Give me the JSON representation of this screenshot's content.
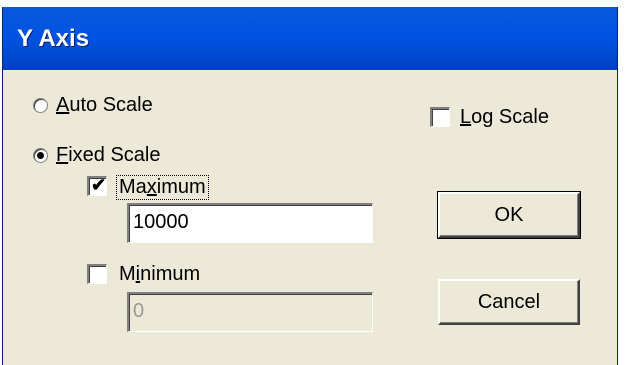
{
  "window": {
    "title": "Y Axis"
  },
  "scale": {
    "auto_label_u": "A",
    "auto_label_rest": "uto Scale",
    "auto_selected": false,
    "fixed_label_u": "F",
    "fixed_label_rest": "ixed Scale",
    "fixed_selected": true,
    "log_label_u": "L",
    "log_label_rest": "og Scale",
    "log_checked": false
  },
  "maximum": {
    "label_pre": "Ma",
    "label_u": "x",
    "label_post": "imum",
    "checked": true,
    "value": "10000"
  },
  "minimum": {
    "label_pre": "M",
    "label_u": "i",
    "label_post": "nimum",
    "checked": false,
    "value": "0"
  },
  "buttons": {
    "ok": "OK",
    "cancel": "Cancel"
  }
}
